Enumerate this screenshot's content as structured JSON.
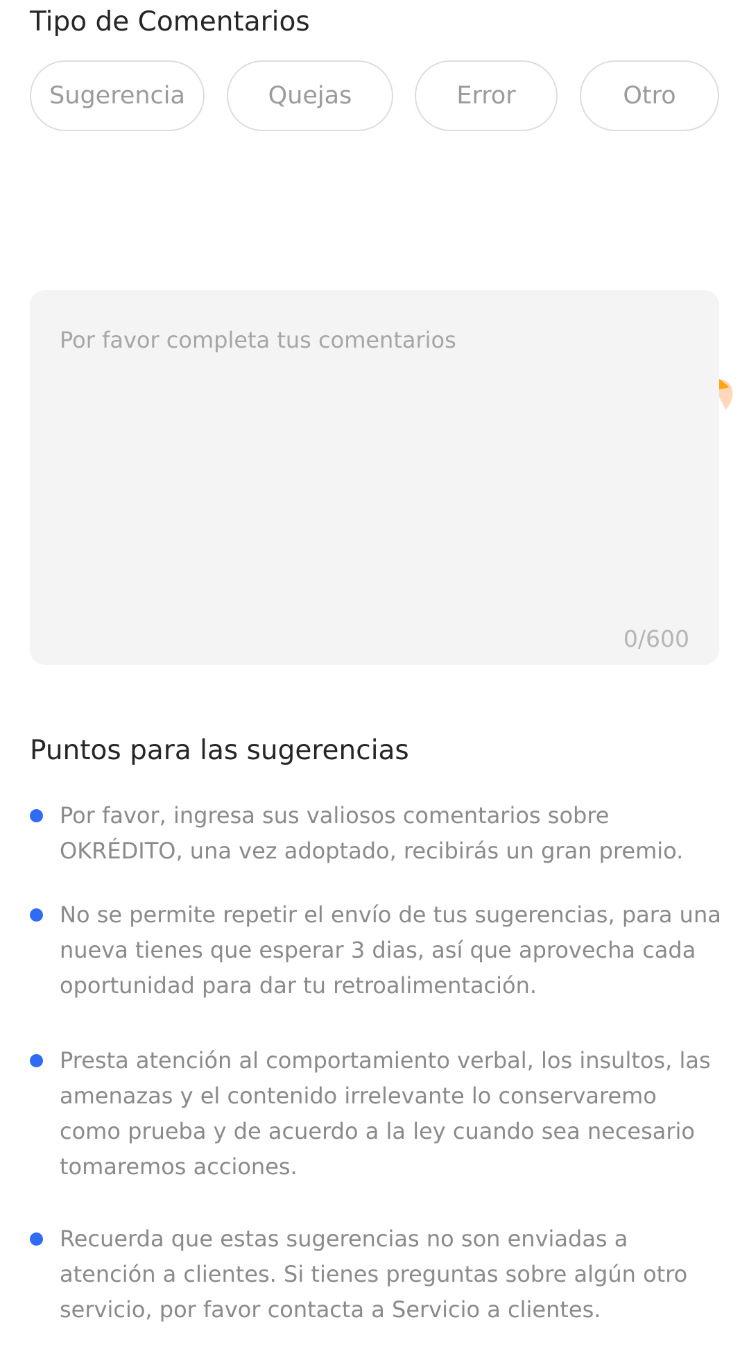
{
  "feedback_type": {
    "title": "Tipo de Comentarios",
    "options": [
      "Sugerencia",
      "Quejas",
      "Error",
      "Otro"
    ]
  },
  "comment": {
    "placeholder": "Por favor completa tus comentarios",
    "value": "",
    "counter": "0/600"
  },
  "illustration": {
    "icon": "pencil-chat-bubble-icon",
    "bubble_color": "#1ed1d9",
    "shirt_color": "#ffa514"
  },
  "tips": {
    "title": "Puntos para las sugerencias",
    "bullet_color": "#2f6bf5",
    "items": [
      "Por favor, ingresa sus valiosos comentarios sobre OKRÉDITO, una vez adoptado, recibirás un gran premio.",
      "No se permite repetir el envío de tus sugerencias, para una nueva tienes que esperar 3 dias, así que aprovecha cada oportunidad para dar tu retroalimentación.",
      "Presta atención al comportamiento verbal, los insultos, las amenazas y el contenido irrelevante lo conservaremo como prueba y de acuerdo a la ley cuando sea necesario tomaremos acciones.",
      "Recuerda que estas sugerencias no son enviadas a atención a clientes. Si tienes preguntas sobre algún otro servicio, por favor contacta a Servicio a clientes."
    ]
  }
}
